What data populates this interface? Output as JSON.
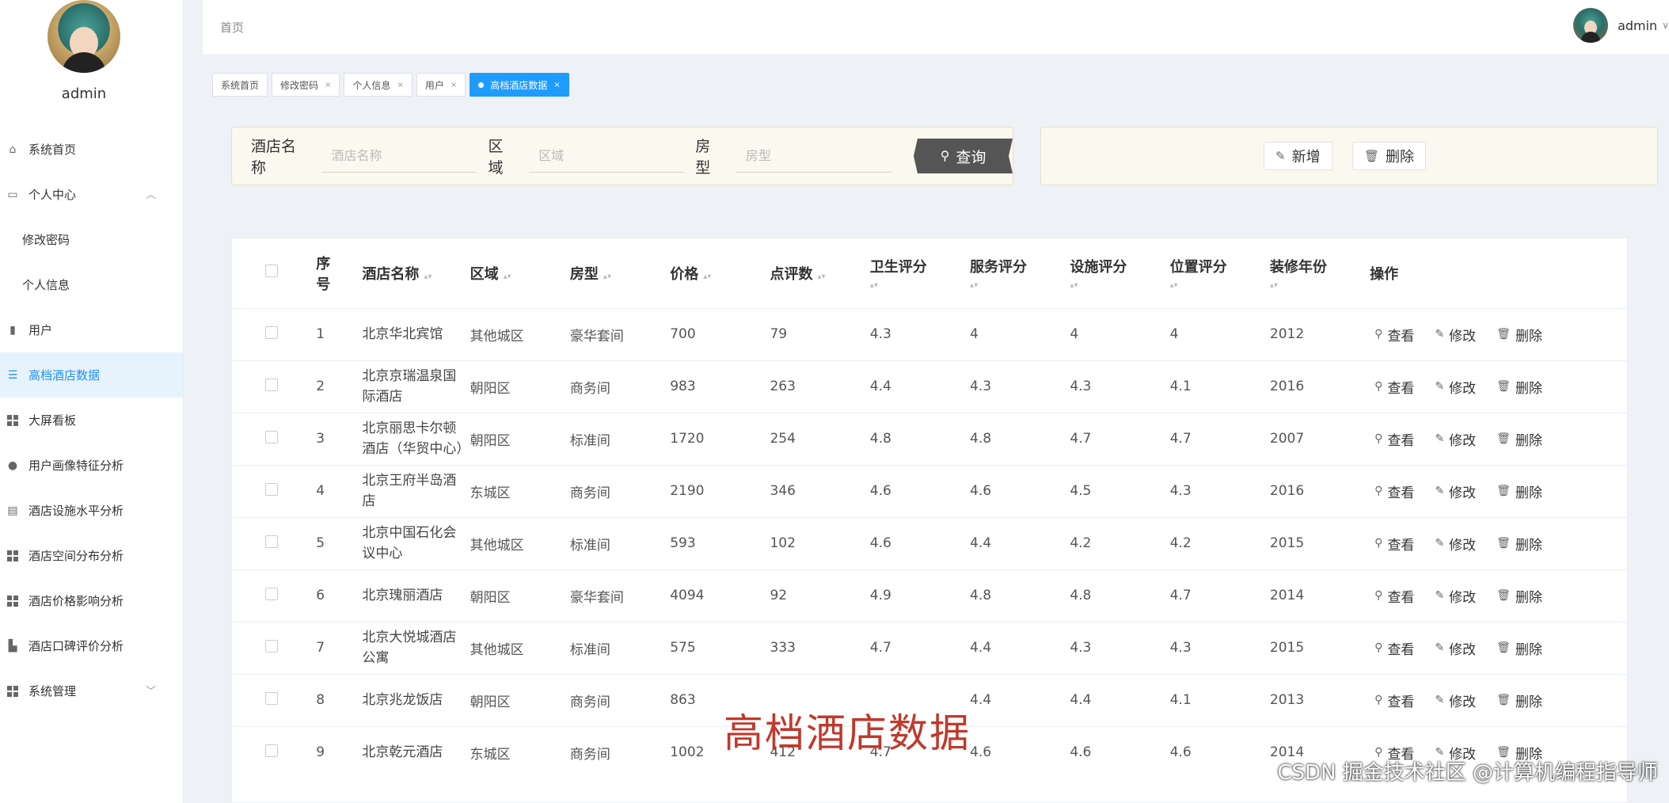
{
  "sidebar": {
    "username": "admin",
    "items": [
      {
        "label": "系统首页",
        "icon": "home-icon",
        "glyph": "⌂"
      },
      {
        "label": "个人中心",
        "icon": "wallet-icon",
        "glyph": "▭",
        "chevron": "︿"
      },
      {
        "label": "修改密码",
        "sub": true
      },
      {
        "label": "个人信息",
        "sub": true
      },
      {
        "label": "用户",
        "icon": "bar-chart-icon",
        "glyph": "▮"
      },
      {
        "label": "高档酒店数据",
        "icon": "sliders-icon",
        "glyph": "☰",
        "active": true
      },
      {
        "label": "大屏看板",
        "icon": "grid-icon"
      },
      {
        "label": "用户画像特征分析",
        "icon": "user-icon",
        "glyph": "●"
      },
      {
        "label": "酒店设施水平分析",
        "icon": "clipboard-icon",
        "glyph": "▤"
      },
      {
        "label": "酒店空间分布分析",
        "icon": "grid-icon"
      },
      {
        "label": "酒店价格影响分析",
        "icon": "grid-icon"
      },
      {
        "label": "酒店口碑评价分析",
        "icon": "chart-icon",
        "glyph": "▙"
      },
      {
        "label": "系统管理",
        "icon": "grid-icon",
        "chevron": "﹀"
      }
    ]
  },
  "header": {
    "breadcrumb": "首页",
    "username": "admin",
    "caret": "∨"
  },
  "tags": [
    {
      "label": "系统首页",
      "closable": false
    },
    {
      "label": "修改密码",
      "closable": true
    },
    {
      "label": "个人信息",
      "closable": true
    },
    {
      "label": "用户",
      "closable": true
    },
    {
      "label": "高档酒店数据",
      "closable": true,
      "active": true
    }
  ],
  "search": {
    "hotel_label": "酒店名称",
    "hotel_placeholder": "酒店名称",
    "area_label": "区域",
    "area_placeholder": "区域",
    "room_label": "房型",
    "room_placeholder": "房型",
    "button": "查询"
  },
  "actions": {
    "add": "新增",
    "delete": "删除"
  },
  "table": {
    "headers": {
      "index_top": "序",
      "index_bottom": "号",
      "name": "酒店名称",
      "area": "区域",
      "room": "房型",
      "price": "价格",
      "reviews": "点评数",
      "hygiene": "卫生评分",
      "service": "服务评分",
      "facility": "设施评分",
      "location": "位置评分",
      "year": "装修年份",
      "ops": "操作"
    },
    "op_labels": {
      "view": "查看",
      "edit": "修改",
      "delete": "删除"
    },
    "rows": [
      {
        "idx": "1",
        "name": "北京华北宾馆",
        "area": "其他城区",
        "room": "豪华套间",
        "price": "700",
        "reviews": "79",
        "hygiene": "4.3",
        "service": "4",
        "facility": "4",
        "location": "4",
        "year": "2012"
      },
      {
        "idx": "2",
        "name": "北京京瑞温泉国际酒店",
        "area": "朝阳区",
        "room": "商务间",
        "price": "983",
        "reviews": "263",
        "hygiene": "4.4",
        "service": "4.3",
        "facility": "4.3",
        "location": "4.1",
        "year": "2016"
      },
      {
        "idx": "3",
        "name": "北京丽思卡尔顿酒店（华贸中心）",
        "area": "朝阳区",
        "room": "标准间",
        "price": "1720",
        "reviews": "254",
        "hygiene": "4.8",
        "service": "4.8",
        "facility": "4.7",
        "location": "4.7",
        "year": "2007"
      },
      {
        "idx": "4",
        "name": "北京王府半岛酒店",
        "area": "东城区",
        "room": "商务间",
        "price": "2190",
        "reviews": "346",
        "hygiene": "4.6",
        "service": "4.6",
        "facility": "4.5",
        "location": "4.3",
        "year": "2016"
      },
      {
        "idx": "5",
        "name": "北京中国石化会议中心",
        "area": "其他城区",
        "room": "标准间",
        "price": "593",
        "reviews": "102",
        "hygiene": "4.6",
        "service": "4.4",
        "facility": "4.2",
        "location": "4.2",
        "year": "2015"
      },
      {
        "idx": "6",
        "name": "北京瑰丽酒店",
        "area": "朝阳区",
        "room": "豪华套间",
        "price": "4094",
        "reviews": "92",
        "hygiene": "4.9",
        "service": "4.8",
        "facility": "4.8",
        "location": "4.7",
        "year": "2014"
      },
      {
        "idx": "7",
        "name": "北京大悦城酒店公寓",
        "area": "其他城区",
        "room": "标准间",
        "price": "575",
        "reviews": "333",
        "hygiene": "4.7",
        "service": "4.4",
        "facility": "4.3",
        "location": "4.3",
        "year": "2015"
      },
      {
        "idx": "8",
        "name": "北京兆龙饭店",
        "area": "朝阳区",
        "room": "商务间",
        "price": "863",
        "reviews": "",
        "hygiene": "",
        "service": "4.4",
        "facility": "4.4",
        "location": "4.1",
        "year": "2013"
      },
      {
        "idx": "9",
        "name": "北京乾元酒店",
        "area": "东城区",
        "room": "商务间",
        "price": "1002",
        "reviews": "412",
        "hygiene": "4.7",
        "service": "4.6",
        "facility": "4.6",
        "location": "4.6",
        "year": "2014"
      }
    ]
  },
  "overlay_title": "高档酒店数据",
  "watermark": "CSDN 掘金技术社区 @计算机编程指导师",
  "colors": {
    "accent": "#1e9bff",
    "active_bg": "#e6f3fd",
    "panel_bg": "#fbf8ef",
    "overlay_text": "#c0392b"
  }
}
